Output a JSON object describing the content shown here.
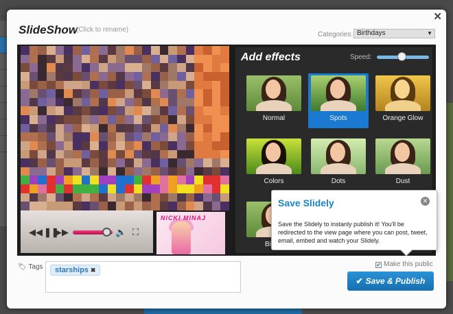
{
  "window": {
    "title": "SlideShow",
    "rename_hint": "(Click to rename)"
  },
  "categories": {
    "label": "Categories:",
    "selected": "Birthdays"
  },
  "effects": {
    "title": "Add effects",
    "speed_label": "Speed:",
    "speed_level": 0.45,
    "items": [
      {
        "label": "Normal",
        "selected": false
      },
      {
        "label": "Spots",
        "selected": true
      },
      {
        "label": "Orange Glow",
        "selected": false
      },
      {
        "label": "Colors",
        "selected": false
      },
      {
        "label": "Dots",
        "selected": false
      },
      {
        "label": "Dust",
        "selected": false
      },
      {
        "label": "Birthd",
        "selected": false
      }
    ]
  },
  "music": {
    "artist": "NICKI MINAJ"
  },
  "popup": {
    "title": "Save Slidely",
    "body": "Save the Slidely to instanly publish it! You'll be redirected to the view page where you can post, tweet, email, embed and watch your Slidely."
  },
  "tags": {
    "label": "Tags",
    "items": [
      "starships"
    ]
  },
  "make_public": {
    "label": "Make this public",
    "checked": true
  },
  "publish_button": {
    "label": "Save & Publish"
  },
  "colors": {
    "accent": "#1a7ad1",
    "progress": "#e0306e"
  }
}
